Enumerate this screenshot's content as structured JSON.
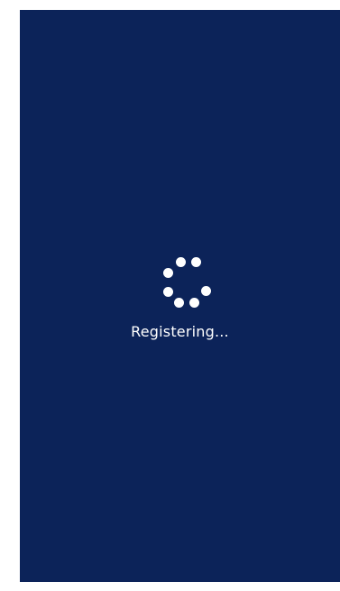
{
  "screen": {
    "background_color": "#0c2359",
    "status_text": "Registering...",
    "text_color": "#ffffff"
  },
  "spinner": {
    "icon": "loading-spinner-icon",
    "dot_color": "#ffffff",
    "dot_count": 7
  }
}
